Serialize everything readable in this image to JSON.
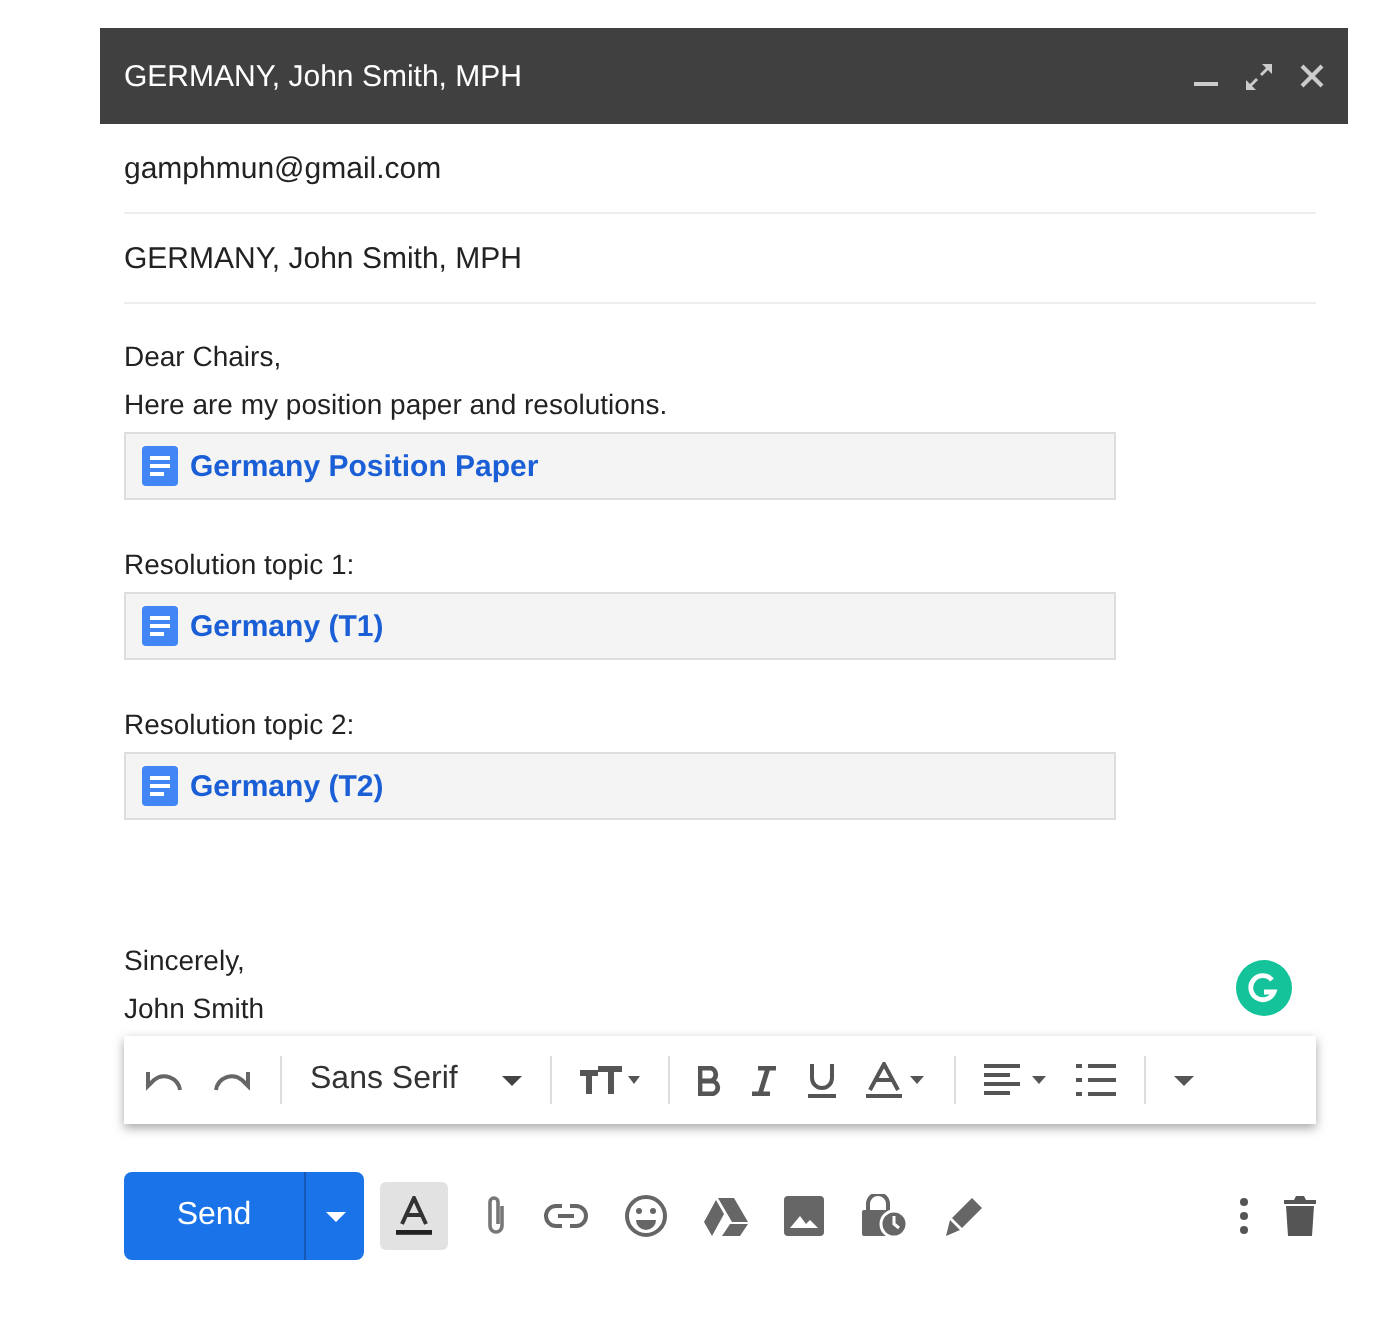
{
  "window": {
    "title": "GERMANY, John Smith, MPH"
  },
  "to": "gamphmun@gmail.com",
  "subject": "GERMANY, John Smith, MPH",
  "body": [
    [
      {
        "kind": "text",
        "text": "Dear Chairs,"
      },
      {
        "kind": "text",
        "text": "Here are my position paper and resolutions."
      },
      {
        "kind": "attachment",
        "text": "Germany Position Paper"
      }
    ],
    [
      {
        "kind": "text",
        "text": "Resolution topic 1:"
      },
      {
        "kind": "attachment",
        "text": "Germany (T1)"
      }
    ],
    [
      {
        "kind": "text",
        "text": "Resolution topic 2:"
      },
      {
        "kind": "attachment",
        "text": "Germany (T2)"
      }
    ]
  ],
  "closing": [
    "Sincerely,",
    "John Smith"
  ],
  "toolbar": {
    "font": "Sans Serif"
  },
  "send_button": "Send",
  "formatting_on": true
}
